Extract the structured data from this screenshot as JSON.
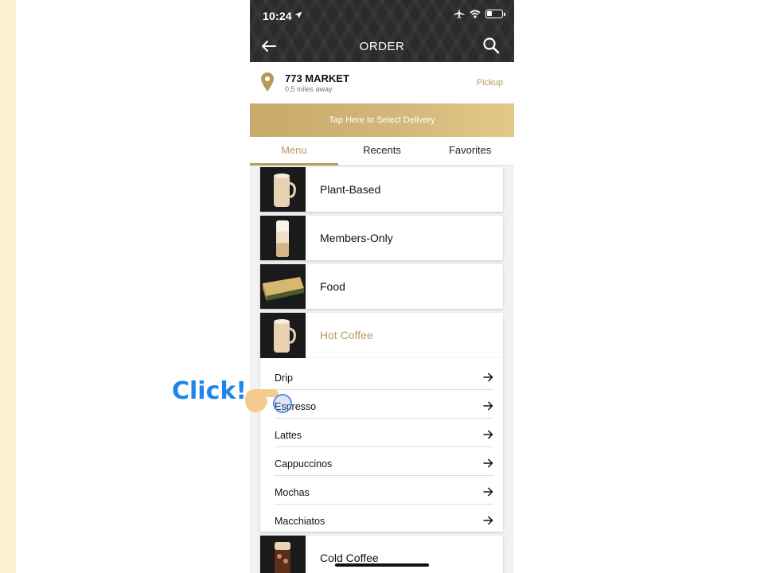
{
  "status_bar": {
    "time": "10:24"
  },
  "nav": {
    "title": "ORDER"
  },
  "store": {
    "name": "773 MARKET",
    "distance": "0,5 miles away",
    "pickup_label": "Pickup"
  },
  "delivery_banner": "Tap Here to Select Delivery",
  "tabs": [
    {
      "label": "Menu",
      "active": true
    },
    {
      "label": "Recents",
      "active": false
    },
    {
      "label": "Favorites",
      "active": false
    }
  ],
  "categories": [
    {
      "label": "Plant-Based",
      "icon": "latte-mug-icon"
    },
    {
      "label": "Members-Only",
      "icon": "iced-drink-icon"
    },
    {
      "label": "Food",
      "icon": "sandwich-icon"
    },
    {
      "label": "Hot Coffee",
      "icon": "latte-mug-icon",
      "expanded": true
    },
    {
      "label": "Cold Coffee",
      "icon": "cold-brew-icon"
    }
  ],
  "hot_coffee_items": [
    "Drip",
    "Espresso",
    "Lattes",
    "Cappuccinos",
    "Mochas",
    "Macchiatos"
  ],
  "overlay": {
    "click_label": "Click!"
  },
  "colors": {
    "accent_gold": "#b89a5c",
    "nav_bg": "#2b2b2b",
    "click_blue": "#1e86e8"
  }
}
